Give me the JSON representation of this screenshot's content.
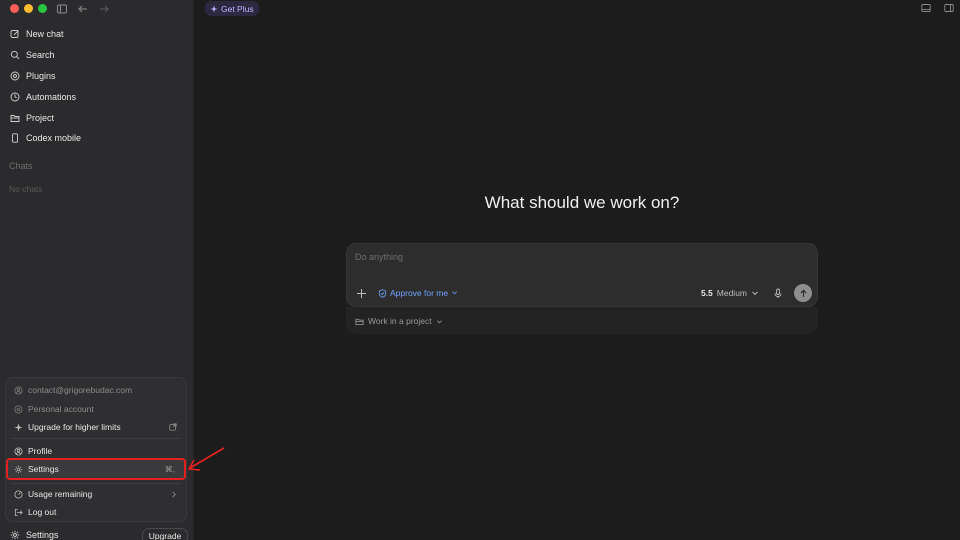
{
  "sidebar": {
    "nav": [
      {
        "label": "New chat",
        "icon": "edit-icon"
      },
      {
        "label": "Search",
        "icon": "search-icon"
      },
      {
        "label": "Plugins",
        "icon": "plugins-icon"
      },
      {
        "label": "Automations",
        "icon": "clock-icon"
      },
      {
        "label": "Project",
        "icon": "folder-icon"
      },
      {
        "label": "Codex mobile",
        "icon": "phone-icon"
      }
    ],
    "chats_label": "Chats",
    "chats_empty": "No chats",
    "bottom": {
      "settings_label": "Settings",
      "upgrade_label": "Upgrade"
    }
  },
  "account_menu": {
    "email": "contact@grigorebudac.com",
    "account_type": "Personal account",
    "upgrade_limits": "Upgrade for higher limits",
    "profile": "Profile",
    "settings": "Settings",
    "settings_shortcut": "⌘,",
    "usage": "Usage remaining",
    "logout": "Log out"
  },
  "header": {
    "get_plus": "Get Plus"
  },
  "main": {
    "headline": "What should we work on?",
    "composer": {
      "placeholder": "Do anything",
      "approve_label": "Approve for me",
      "model_version": "5.5",
      "model_effort": "Medium"
    },
    "project_select": "Work in a project"
  },
  "colors": {
    "sidebar_bg": "#2b2b2d",
    "main_bg": "#1c1c1c",
    "accent_blue": "#6ea3ff",
    "get_plus_purple": "#c6b2ff",
    "annotation_red": "#e52020"
  }
}
